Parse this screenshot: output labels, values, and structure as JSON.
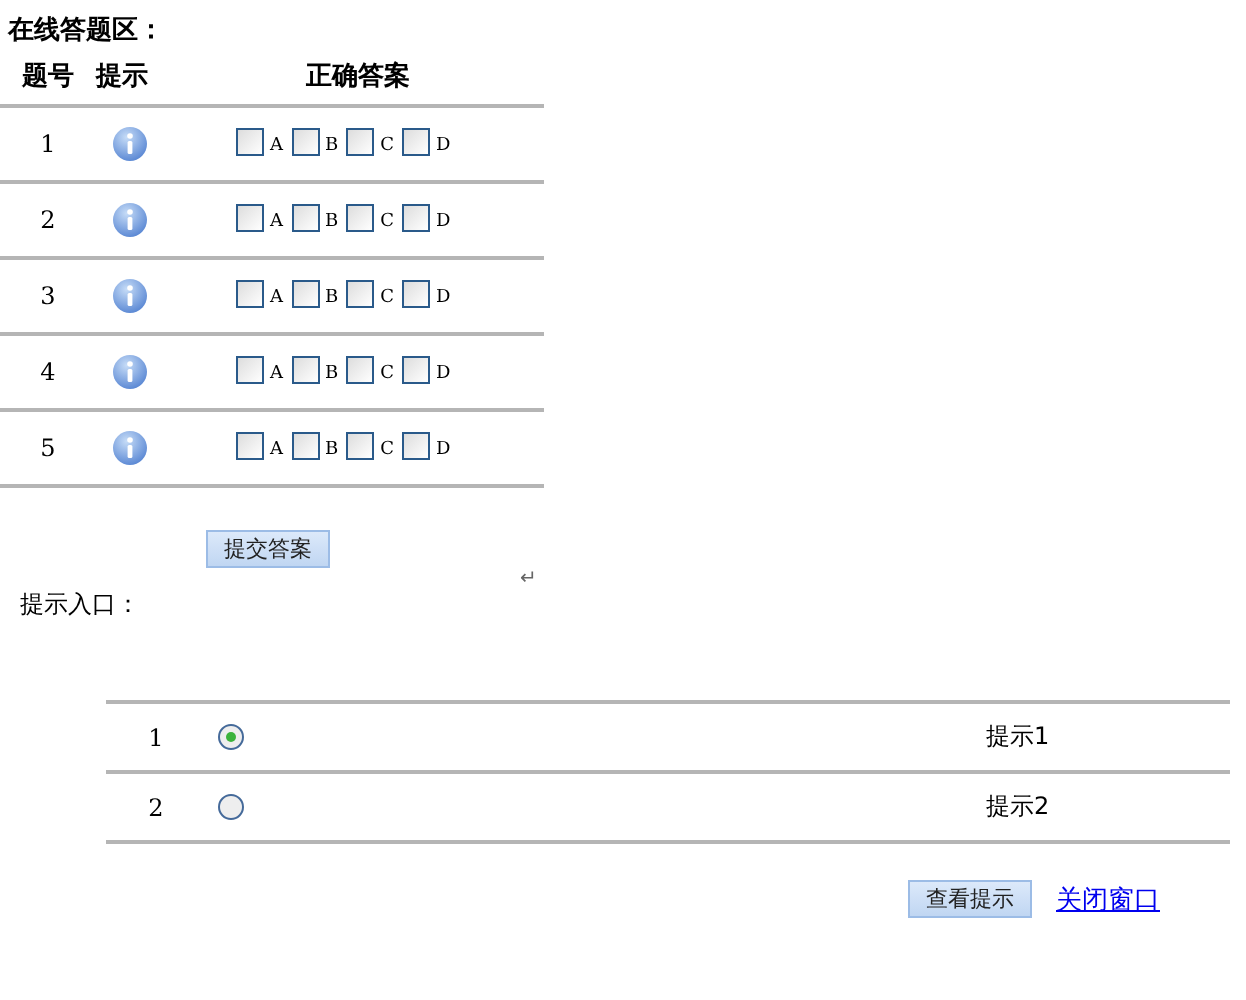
{
  "title": "在线答题区：",
  "columns": [
    "题号",
    "提示",
    "正确答案"
  ],
  "questions": [
    {
      "number": "1",
      "options": [
        {
          "label": "A",
          "checked": false
        },
        {
          "label": "B",
          "checked": false
        },
        {
          "label": "C",
          "checked": false
        },
        {
          "label": "D",
          "checked": false
        }
      ]
    },
    {
      "number": "2",
      "options": [
        {
          "label": "A",
          "checked": false
        },
        {
          "label": "B",
          "checked": false
        },
        {
          "label": "C",
          "checked": false
        },
        {
          "label": "D",
          "checked": false
        }
      ]
    },
    {
      "number": "3",
      "options": [
        {
          "label": "A",
          "checked": false
        },
        {
          "label": "B",
          "checked": false
        },
        {
          "label": "C",
          "checked": false
        },
        {
          "label": "D",
          "checked": false
        }
      ]
    },
    {
      "number": "4",
      "options": [
        {
          "label": "A",
          "checked": false
        },
        {
          "label": "B",
          "checked": false
        },
        {
          "label": "C",
          "checked": false
        },
        {
          "label": "D",
          "checked": false
        }
      ]
    },
    {
      "number": "5",
      "options": [
        {
          "label": "A",
          "checked": false
        },
        {
          "label": "B",
          "checked": false
        },
        {
          "label": "C",
          "checked": false
        },
        {
          "label": "D",
          "checked": false
        }
      ]
    }
  ],
  "submit_button": "提交答案",
  "paragraph_mark": "↵",
  "hint_heading": "提示入口：",
  "hints": [
    {
      "number": "1",
      "selected": true,
      "label": "提示1"
    },
    {
      "number": "2",
      "selected": false,
      "label": "提示2"
    }
  ],
  "view_button": "查看提示",
  "close_link": "关闭窗口"
}
